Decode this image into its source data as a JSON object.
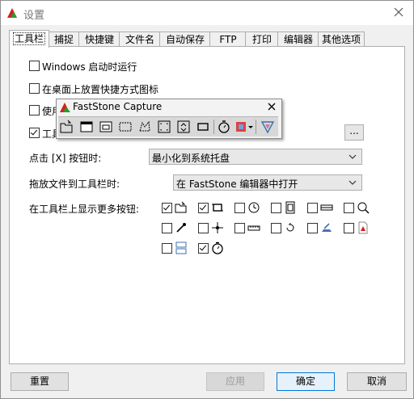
{
  "window": {
    "title": "设置"
  },
  "tabs": [
    "工具栏",
    "捕捉",
    "快捷键",
    "文件名",
    "自动保存",
    "FTP",
    "打印",
    "编辑器",
    "其他选项"
  ],
  "options": {
    "startup": "Windows 启动时运行",
    "desktop_shortcut": "在桌面上放置快捷方式图标",
    "use_partial": "使用",
    "toolbar_partial": "工具"
  },
  "more_button": "...",
  "click_x": {
    "label": "点击 [X] 按钮时:",
    "value": "最小化到系统托盘"
  },
  "drag_file": {
    "label": "拖放文件到工具栏时:",
    "value": "在 FastStone 编辑器中打开"
  },
  "more_buttons_label": "在工具栏上显示更多按钮:",
  "floating_toolbar": {
    "title": "FastStone Capture"
  },
  "buttons": {
    "reset": "重置",
    "apply": "应用",
    "ok": "确定",
    "cancel": "取消"
  },
  "checkbox_states": {
    "startup": false,
    "desktop_shortcut": false,
    "use": false,
    "toolbar": true,
    "extra": [
      true,
      true,
      false,
      false,
      false,
      false,
      false,
      false,
      false,
      false,
      false,
      false,
      false,
      true
    ]
  },
  "extra_button_icons": [
    "open-folder-icon",
    "capture-rect-icon",
    "timer-clock-icon",
    "film-icon",
    "scroll-bar-icon",
    "magnifier-icon",
    "eyedropper-icon",
    "crosshair-icon",
    "ruler-icon",
    "repeat-icon",
    "draw-icon",
    "pdf-icon",
    "screen-split-icon",
    "delay-timer-icon"
  ]
}
